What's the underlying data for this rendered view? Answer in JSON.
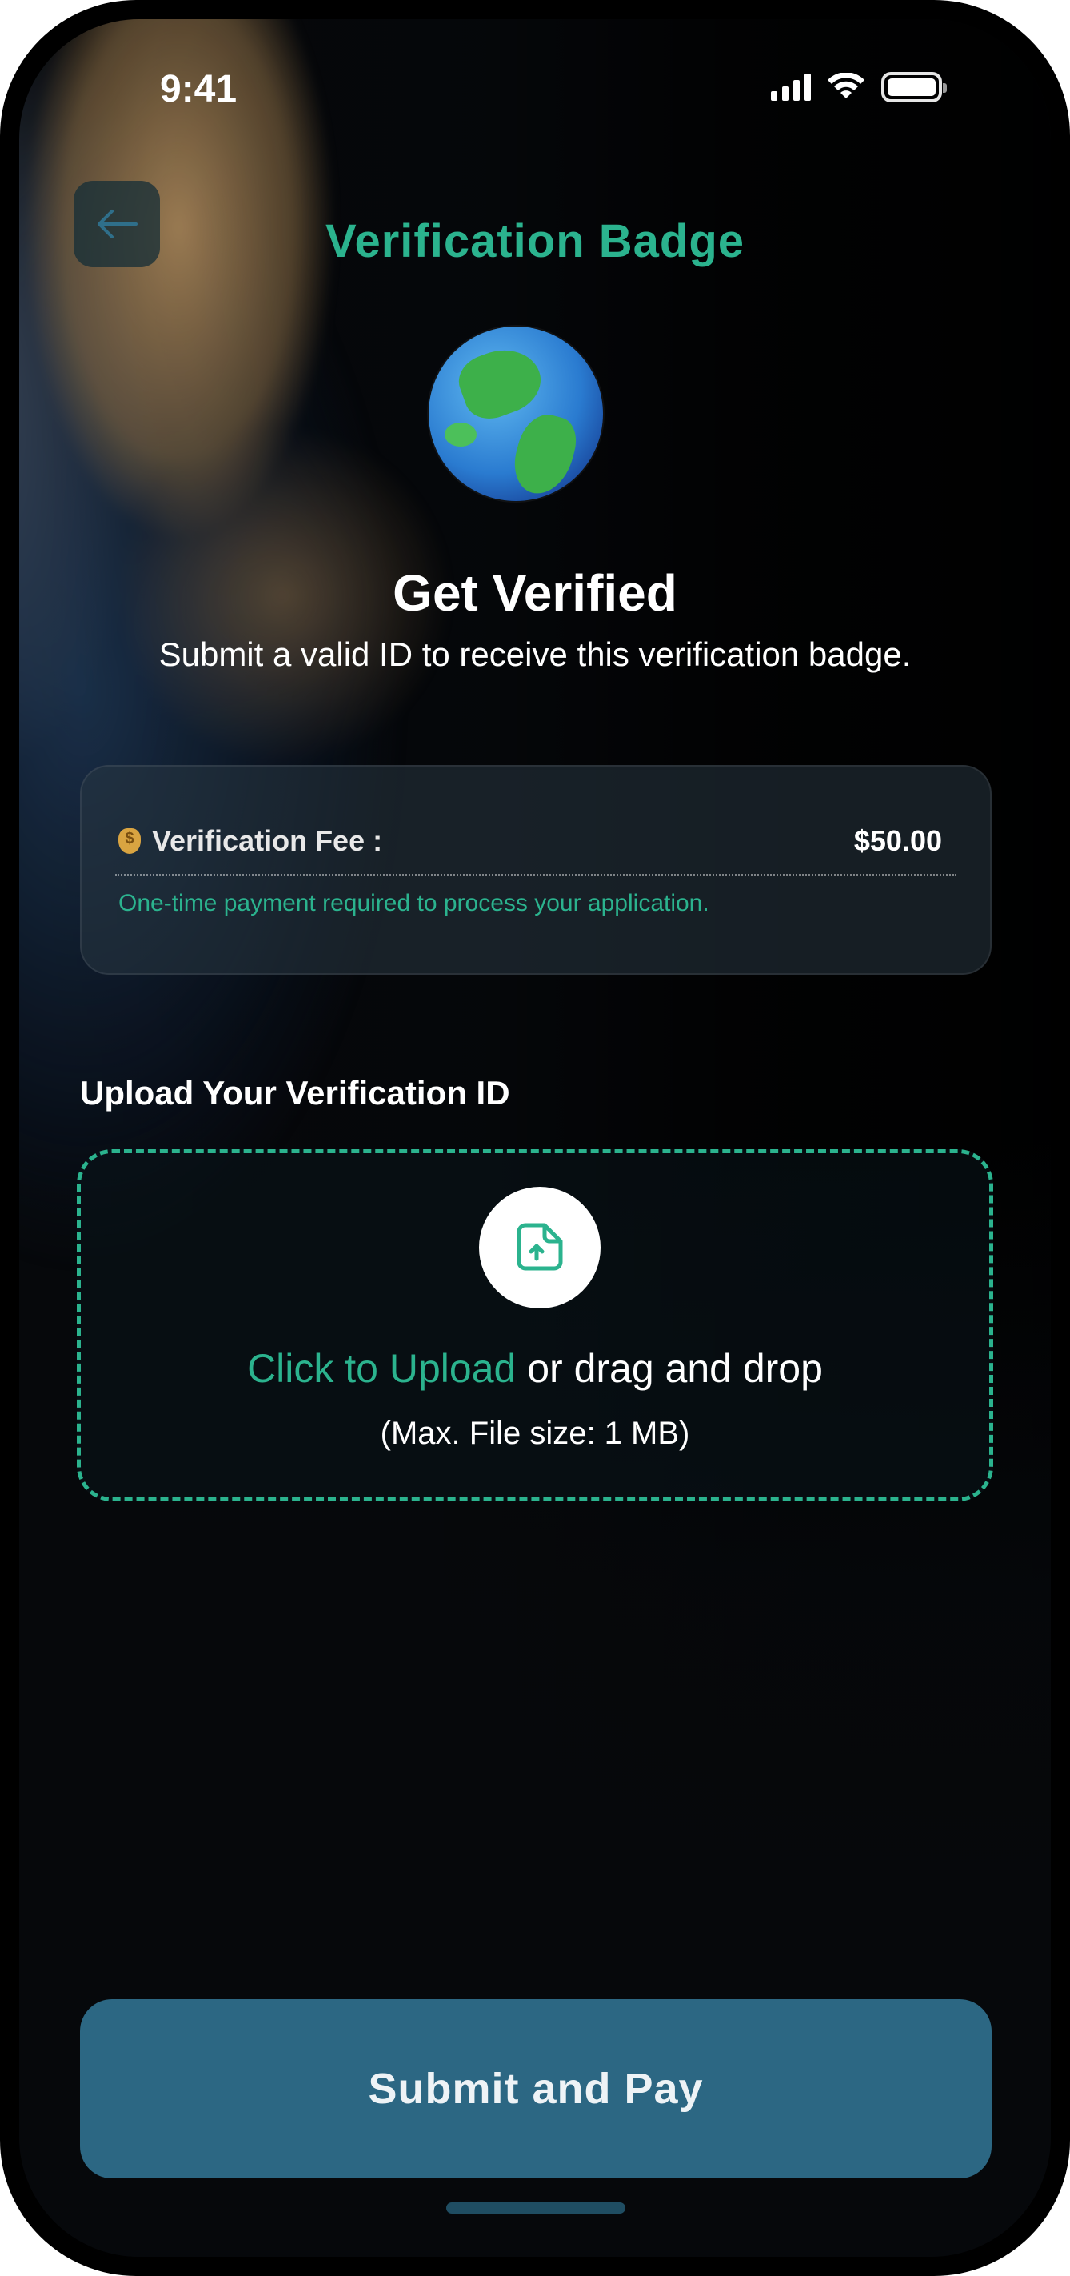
{
  "status_bar": {
    "time": "9:41"
  },
  "header": {
    "title": "Verification Badge",
    "back_icon": "arrow-left-icon"
  },
  "hero": {
    "icon": "globe-icon",
    "title": "Get Verified",
    "subtitle": "Submit a valid ID to receive this verification badge."
  },
  "fee": {
    "icon": "money-bag-icon",
    "label": "Verification Fee :",
    "amount": "$50.00",
    "note": "One-time payment required to process your application."
  },
  "upload": {
    "heading": "Upload Your Verification ID",
    "icon": "file-upload-icon",
    "link_label": "Click to Upload",
    "text": " or drag and drop",
    "limit": "(Max. File size: 1 MB)"
  },
  "actions": {
    "submit_label": "Submit and Pay"
  },
  "colors": {
    "accent": "#2bb38e",
    "button": "#2c6783",
    "background": "#06080b"
  }
}
